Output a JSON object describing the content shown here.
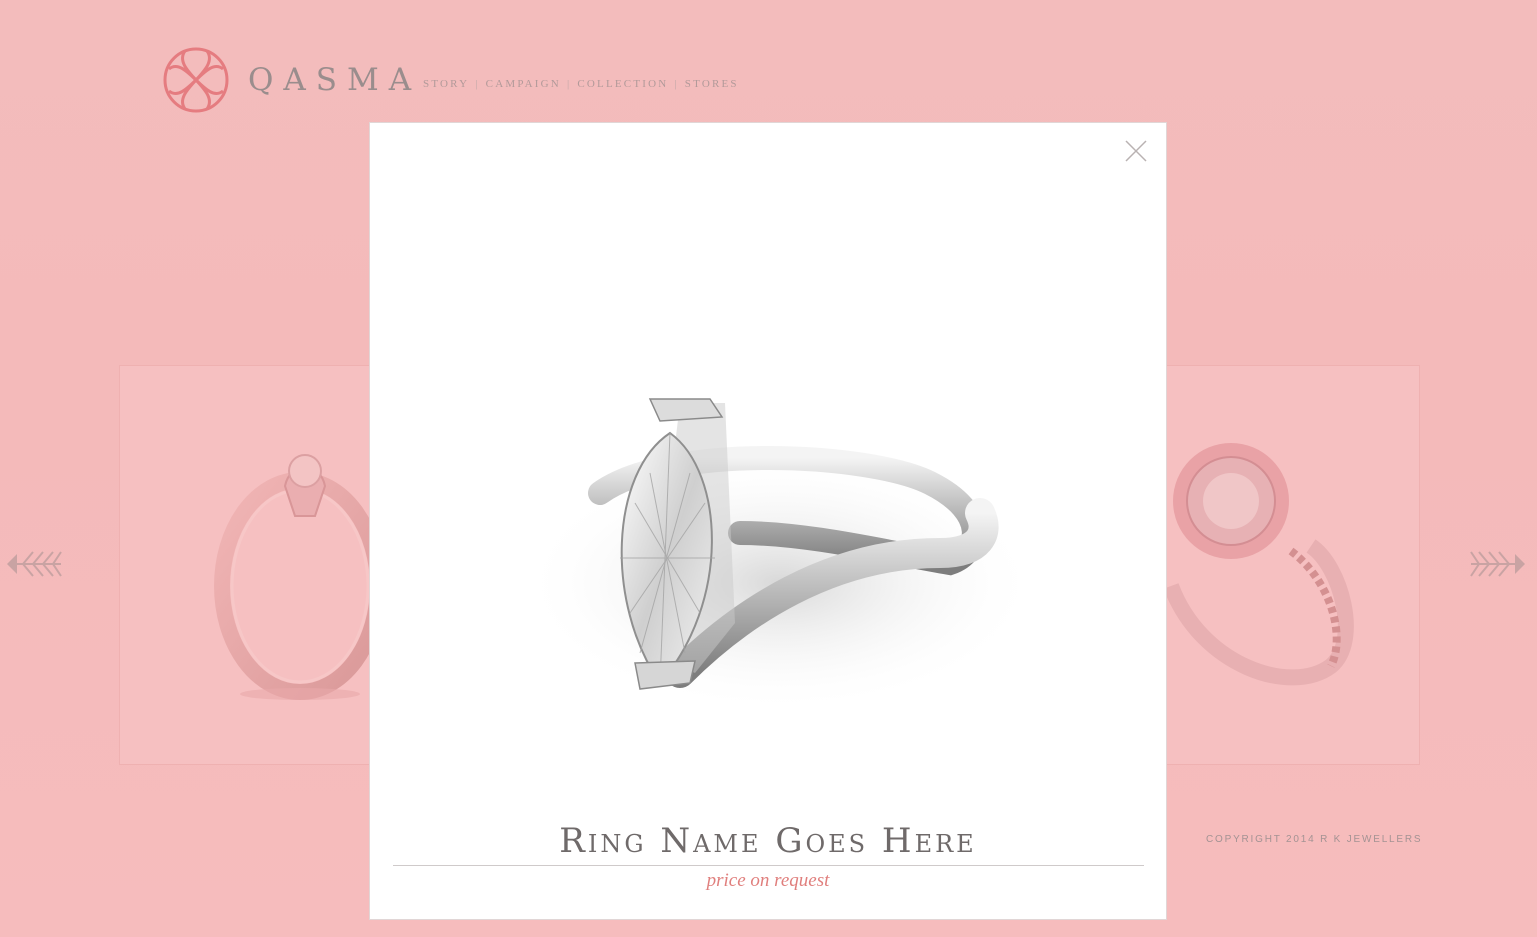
{
  "header": {
    "brand": "QASMA",
    "nav": [
      "STORY",
      "CAMPAIGN",
      "COLLECTION",
      "STORES"
    ]
  },
  "footer": {
    "copyright": "COPYRIGHT 2014 R K JEWELLERS"
  },
  "modal": {
    "product_name": "Ring Name Goes Here",
    "price_text": "price on request"
  },
  "colors": {
    "background": "#f4baba",
    "accent": "#e07f7d",
    "modal_bg": "#ffffff"
  },
  "icons": [
    "qasma-logo-icon",
    "close-icon",
    "arrow-left-icon",
    "arrow-right-icon"
  ]
}
